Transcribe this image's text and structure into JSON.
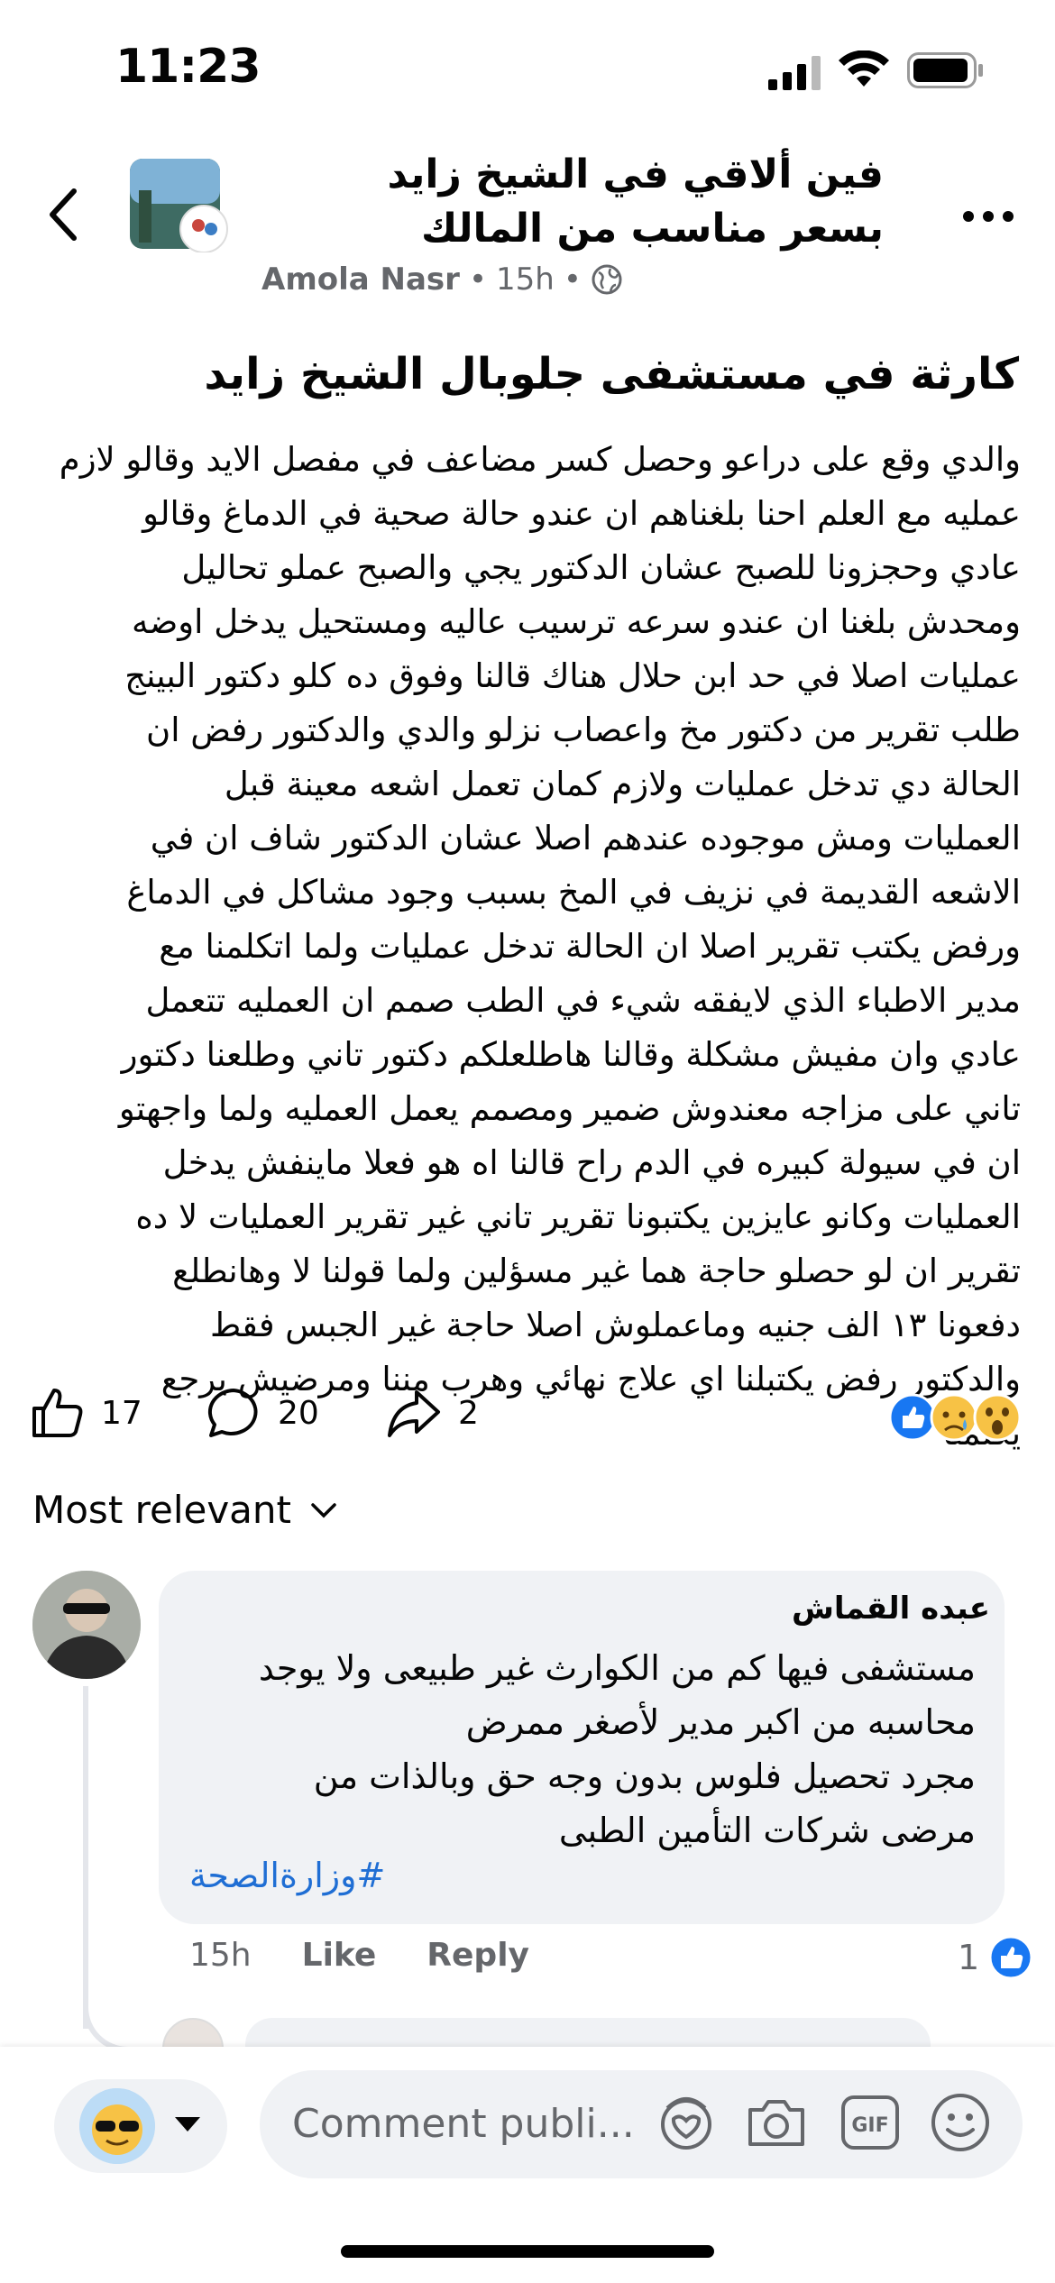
{
  "status_bar": {
    "time": "11:23"
  },
  "header": {
    "group_title": "فين ألاقي في الشيخ زايد بسعر  مناسب من المالك",
    "author": "Amola Nasr",
    "time_ago": "15h",
    "separator": "•",
    "privacy_icon": "globe-icon"
  },
  "post": {
    "title": "كارثة في مستشفى جلوبال الشيخ زايد",
    "body": "والدي وقع على دراعو وحصل كسر مضاعف في مفصل الايد وقالو لازم\nعمليه مع العلم احنا بلغناهم ان عندو حالة صحية في الدماغ وقالو\nعادي وحجزونا للصبح عشان الدكتور يجي والصبح عملو تحاليل\nومحدش بلغنا ان عندو سرعه ترسيب عاليه ومستحيل يدخل اوضه\nعمليات اصلا في حد ابن حلال هناك قالنا وفوق ده كلو دكتور البينج\nطلب تقرير من دكتور مخ واعصاب نزلو والدي والدكتور رفض ان\nالحالة دي تدخل عمليات ولازم كمان تعمل اشعه معينة قبل\nالعمليات ومش موجوده عندهم اصلا عشان الدكتور شاف ان في\nالاشعه القديمة في نزيف في المخ بسبب وجود مشاكل في الدماغ\nورفض يكتب تقرير اصلا ان الحالة تدخل عمليات ولما اتكلمنا مع\nمدير الاطباء الذي لايفقه شيء في الطب صمم ان العمليه تتعمل\nعادي وان مفيش مشكلة وقالنا هاطلعلكم دكتور تاني وطلعنا دكتور\nتاني على مزاجه معندوش ضمير ومصمم يعمل العمليه ولما واجهتو\nان في سيولة كبيره في الدم راح قالنا اه هو فعلا ماينفش يدخل\nالعمليات وكانو عايزين يكتبونا تقرير تاني غير تقرير العمليات لا ده\nتقرير ان لو حصلو حاجة هما غير مسؤلين ولما قولنا لا وهانطلع\nدفعونا ١٣ الف جنيه وماعملوش اصلا حاجة غير الجبس فقط\nوالدكتور رفض يكتبلنا اي علاج نهائي وهرب مننا ومرضيش يرجع\nيكلمنا"
  },
  "engagement": {
    "likes": "17",
    "comments": "20",
    "shares": "2",
    "reaction_icons": [
      "like-icon",
      "sad-face-icon",
      "wow-face-icon"
    ],
    "colors": {
      "like_blue": "#1877f2",
      "emoji_yellow": "#f7c245"
    }
  },
  "sort": {
    "label": "Most relevant"
  },
  "comment": {
    "author": "عبده القماش",
    "text": "مستشفى فيها كم من الكوارث غير طبيعى ولا يوجد\nمحاسبه من اكبر مدير لأصغر ممرض\nمجرد تحصيل فلوس بدون وجه حق وبالذات من\nمرضى شركات التأمين الطبى",
    "hashtag": "#وزارةالصحة",
    "time_ago": "15h",
    "like_label": "Like",
    "reply_label": "Reply",
    "like_count": "1"
  },
  "composer": {
    "placeholder": "Comment publi..."
  }
}
